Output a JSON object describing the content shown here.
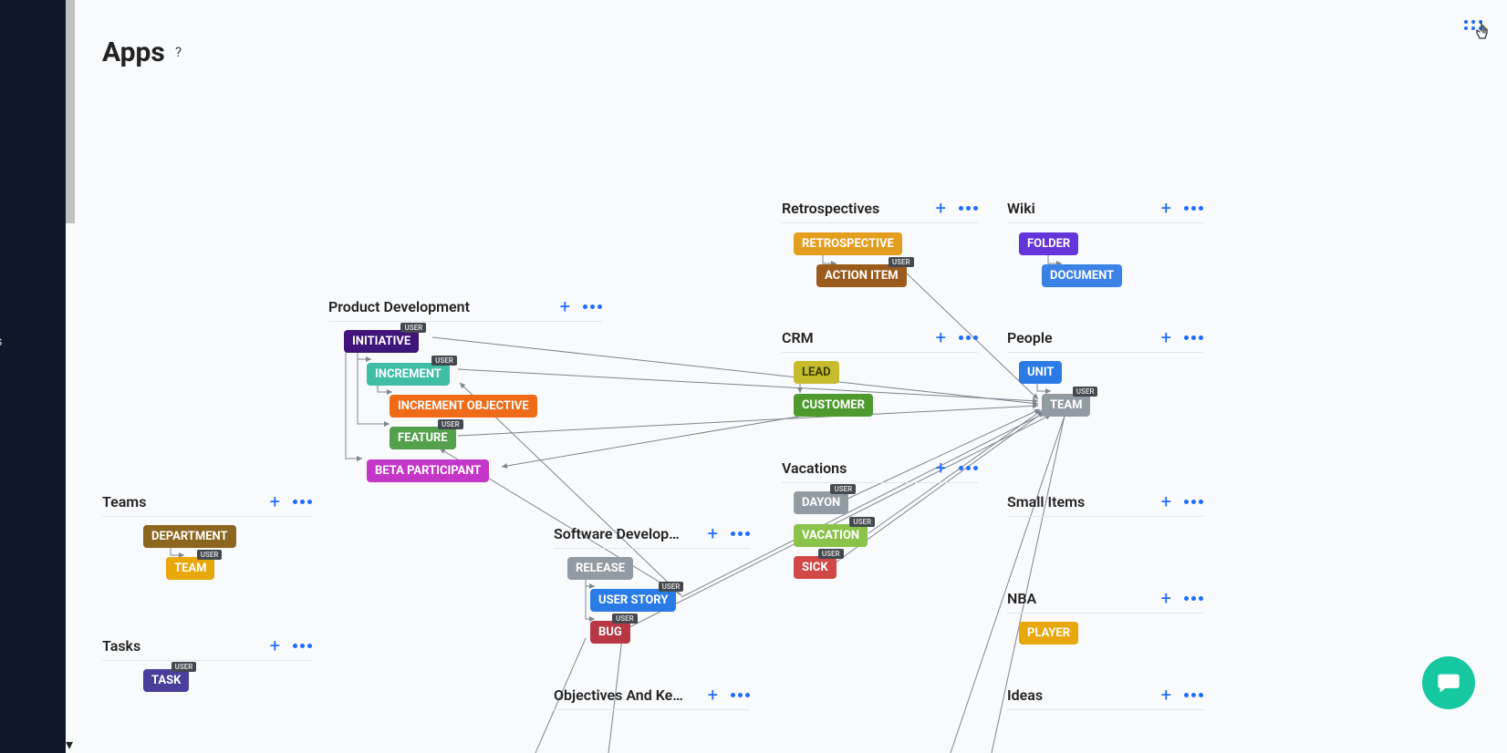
{
  "page": {
    "title": "Apps",
    "help": "?"
  },
  "sidebar": {
    "partial_text": "ts"
  },
  "groups": {
    "teams": {
      "title": "Teams"
    },
    "tasks": {
      "title": "Tasks"
    },
    "product_dev": {
      "title": "Product Development"
    },
    "software_dev": {
      "title": "Software Develop…"
    },
    "okr": {
      "title": "Objectives And Ke…"
    },
    "retrospectives": {
      "title": "Retrospectives"
    },
    "crm": {
      "title": "CRM"
    },
    "vacations": {
      "title": "Vacations"
    },
    "wiki": {
      "title": "Wiki"
    },
    "people": {
      "title": "People"
    },
    "small_items": {
      "title": "Small Items"
    },
    "nba": {
      "title": "NBA"
    },
    "ideas": {
      "title": "Ideas"
    }
  },
  "chips": {
    "department": "DEPARTMENT",
    "team1": "TEAM",
    "task": "TASK",
    "initiative": "INITIATIVE",
    "increment": "INCREMENT",
    "increment_obj": "INCREMENT OBJECTIVE",
    "feature": "FEATURE",
    "beta_participant": "BETA PARTICIPANT",
    "release": "RELEASE",
    "user_story": "USER STORY",
    "bug": "BUG",
    "retrospective": "RETROSPECTIVE",
    "action_item": "ACTION ITEM",
    "lead": "LEAD",
    "customer": "CUSTOMER",
    "dayon": "DAYON",
    "vacation": "VACATION",
    "sick": "SICK",
    "folder": "FOLDER",
    "document": "DOCUMENT",
    "unit": "UNIT",
    "team2": "TEAM",
    "player": "PLAYER"
  },
  "tag": "USER"
}
